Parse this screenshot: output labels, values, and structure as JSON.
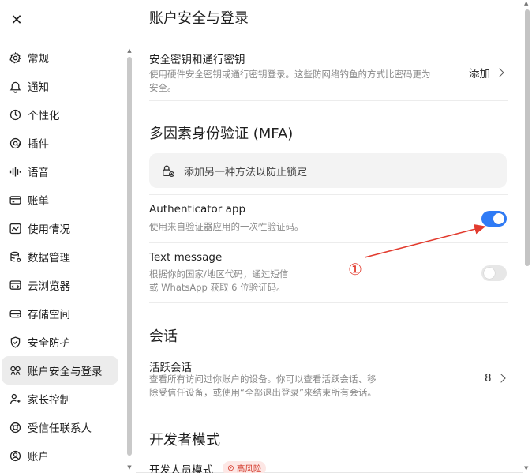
{
  "sidebar": {
    "close_label": "✕",
    "items": [
      {
        "label": "常规",
        "icon": "gear-icon"
      },
      {
        "label": "通知",
        "icon": "bell-icon"
      },
      {
        "label": "个性化",
        "icon": "personalize-icon"
      },
      {
        "label": "插件",
        "icon": "plugin-icon"
      },
      {
        "label": "语音",
        "icon": "voice-icon"
      },
      {
        "label": "账单",
        "icon": "billing-icon"
      },
      {
        "label": "使用情况",
        "icon": "usage-icon"
      },
      {
        "label": "数据管理",
        "icon": "database-icon"
      },
      {
        "label": "云浏览器",
        "icon": "cloud-browser-icon"
      },
      {
        "label": "存储空间",
        "icon": "storage-icon"
      },
      {
        "label": "安全防护",
        "icon": "shield-icon"
      },
      {
        "label": "账户安全与登录",
        "icon": "key-icon",
        "active": true
      },
      {
        "label": "家长控制",
        "icon": "parental-icon"
      },
      {
        "label": "受信任联系人",
        "icon": "lifebuoy-icon"
      },
      {
        "label": "账户",
        "icon": "account-icon"
      }
    ]
  },
  "main": {
    "title": "账户安全与登录",
    "passkey": {
      "title": "安全密钥和通行密钥",
      "desc_line1": "使用硬件安全密钥或通行密钥登录。这些防网络钓鱼的方式比密码更为",
      "desc_line2": "安全。",
      "action": "添加"
    },
    "mfa": {
      "heading": "多因素身份验证 (MFA)",
      "add_method": "添加另一种方法以防止锁定",
      "authenticator": {
        "title": "Authenticator app",
        "desc": "使用来自验证器应用的一次性验证码。",
        "enabled": true
      },
      "sms": {
        "title": "Text message",
        "desc_line1": "根据你的国家/地区代码，通过短信",
        "desc_line2": "或 WhatsApp 获取 6 位验证码。",
        "enabled": false
      }
    },
    "sessions": {
      "heading": "会话",
      "title": "活跃会话",
      "desc_line1": "查看所有访问过你账户的设备。你可以查看活跃会话、移",
      "desc_line2": "除受信任设备，或使用“全部退出登录”来结束所有会话。",
      "count": "8"
    },
    "developer": {
      "heading": "开发者模式",
      "title": "开发人员模式",
      "badge": "高风险"
    }
  },
  "annotation": {
    "number": "①",
    "color": "#e23b2e"
  },
  "colors": {
    "accent": "#2f7bf6",
    "danger": "#d33a2c"
  }
}
